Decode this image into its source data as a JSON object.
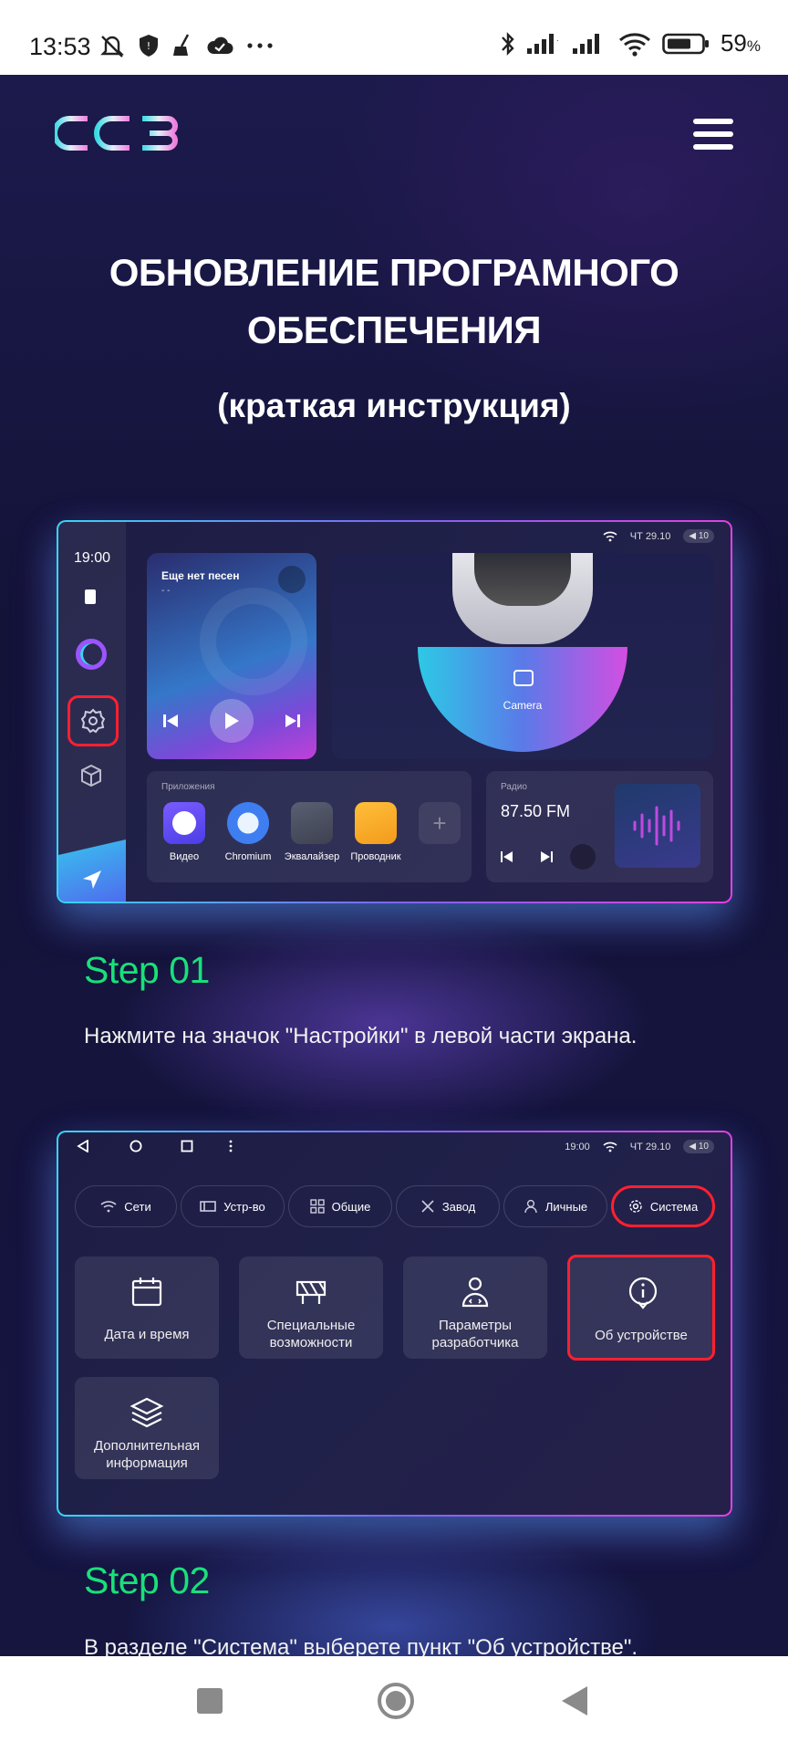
{
  "status_bar": {
    "time": "13:53",
    "battery": "59",
    "battery_unit": "%"
  },
  "header": {
    "logo_text": "CC3"
  },
  "hero": {
    "title_line1": "ОБНОВЛЕНИЕ ПРОГРАМНОГО",
    "title_line2": "ОБЕСПЕЧЕНИЯ",
    "subtitle": "(краткая инструкция)"
  },
  "screen1": {
    "clock": "19:00",
    "date": "ЧТ 29.10",
    "volume": "10",
    "music_title": "Еще нет песен",
    "music_sub": "- -",
    "camera_label": "Camera",
    "apps_heading": "Приложения",
    "apps": [
      "Видео",
      "Chromium",
      "Эквалайзер",
      "Проводник"
    ],
    "radio_heading": "Радио",
    "radio_freq": "87.50 FM"
  },
  "steps": [
    {
      "title": "Step 01",
      "text": "Нажмите на значок \"Настройки\" в левой части экрана."
    },
    {
      "title": "Step 02",
      "text": "В разделе \"Система\" выберете пункт \"Об устройстве\"."
    }
  ],
  "screen2": {
    "clock": "19:00",
    "date": "ЧТ 29.10",
    "volume": "10",
    "tabs": [
      "Сети",
      "Устр-во",
      "Общие",
      "Завод",
      "Личные",
      "Система"
    ],
    "cards": [
      [
        "Дата и время"
      ],
      [
        "Специальные",
        "возможности"
      ],
      [
        "Параметры",
        "разработчика"
      ],
      [
        "Об устройстве"
      ],
      [
        "Дополнительная",
        "информация"
      ]
    ]
  }
}
